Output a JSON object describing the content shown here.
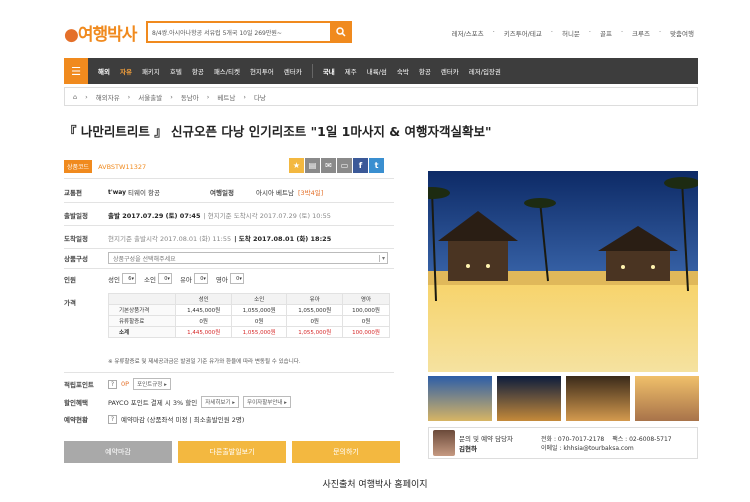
{
  "header": {
    "logo": "여행박사",
    "search_value": "8/4쌍.아시아나항공 서유럽 5개국 10일 269만원~",
    "top_links": [
      "레저/스포츠",
      "키즈투어/테교",
      "허니문",
      "골프",
      "크루즈",
      "맞춤여행"
    ]
  },
  "nav": {
    "items": [
      "해외",
      "자유",
      "패키지",
      "호텔",
      "항공",
      "패스/티켓",
      "현지투어",
      "렌터카"
    ],
    "items2": [
      "국내",
      "제주",
      "내륙/섬",
      "숙박",
      "항공",
      "렌터카",
      "레저/입장권"
    ]
  },
  "breadcrumb": [
    "해외자유",
    "서울출발",
    "동남아",
    "베트남",
    "다낭"
  ],
  "title": "『 나만리트리트 』 신규오픈 다낭 인기리조트 \"1일 1마사지 & 여행자객실확보\"",
  "product": {
    "code_label": "상품코드",
    "code": "AVBSTW11327",
    "transport_label": "교통편",
    "airline_logo": "t'way",
    "airline": "티웨이 항공",
    "itinerary_label": "여행일정",
    "itinerary": "아시아 베트남",
    "itinerary_days": "[3박4일]",
    "depart_label": "출발일정",
    "depart_main": "출발 2017.07.29 (토) 07:45",
    "depart_local": "| 현지기준 도착시각 2017.07.29 (토) 10:55",
    "arrive_label": "도착일정",
    "arrive_local": "현지기준 출발시각 2017.08.01 (화) 11:55",
    "arrive_main": "| 도착 2017.08.01 (화) 18:25",
    "option_label": "상품구성",
    "option_placeholder": "상품구성을 선택해주세요",
    "people_label": "인원",
    "people": [
      {
        "label": "성인",
        "value": "6"
      },
      {
        "label": "소인",
        "value": "0"
      },
      {
        "label": "유아",
        "value": "0"
      },
      {
        "label": "영아",
        "value": "0"
      }
    ],
    "price_label": "가격",
    "price_headers": [
      "",
      "성인",
      "소인",
      "유아",
      "영아"
    ],
    "price_rows": [
      {
        "name": "기본상품가격",
        "values": [
          "1,445,000원",
          "1,055,000원",
          "1,055,000원",
          "100,000원"
        ]
      },
      {
        "name": "유류할증료",
        "values": [
          "0원",
          "0원",
          "0원",
          "0원"
        ]
      },
      {
        "name": "소계",
        "values": [
          "1,445,000원",
          "1,055,000원",
          "1,055,000원",
          "100,000원"
        ]
      }
    ],
    "price_note": "※ 유류할증료 및 제세공과금은 발권일 기준 유가와 환율에 따라 변동될 수 있습니다.",
    "points_label": "적립포인트",
    "points_q": "?",
    "points_value": "0P",
    "points_button": "포인트규정 ▸",
    "discount_label": "할인혜택",
    "discount_text": "PAYCO 포인트 결제 시 3% 할인",
    "discount_btn1": "자세히보기 ▸",
    "discount_btn2": "무이자할부안내 ▸",
    "reserve_label": "예약현황",
    "reserve_q": "?",
    "reserve_text": "예약마감 (상품좌석 미정 | 최소출발인원 2명)"
  },
  "buttons": {
    "closed": "예약마감",
    "other_dates": "다른출발일보기",
    "inquiry": "문의하기"
  },
  "contact": {
    "title": "문의 및 예약 담당자",
    "name": "김현하",
    "tel": "전화 : 070-7017-2178",
    "fax": "팩스 : 02-6008-5717",
    "email": "이메일 : khhsia@tourbaksa.com"
  },
  "caption": "사진출처 여행박사 홈페이지",
  "colors": {
    "accent": "#f08a1e",
    "nav": "#3d3d3d",
    "closed_btn": "#a9a9a9",
    "action_btn": "#f3b840"
  }
}
